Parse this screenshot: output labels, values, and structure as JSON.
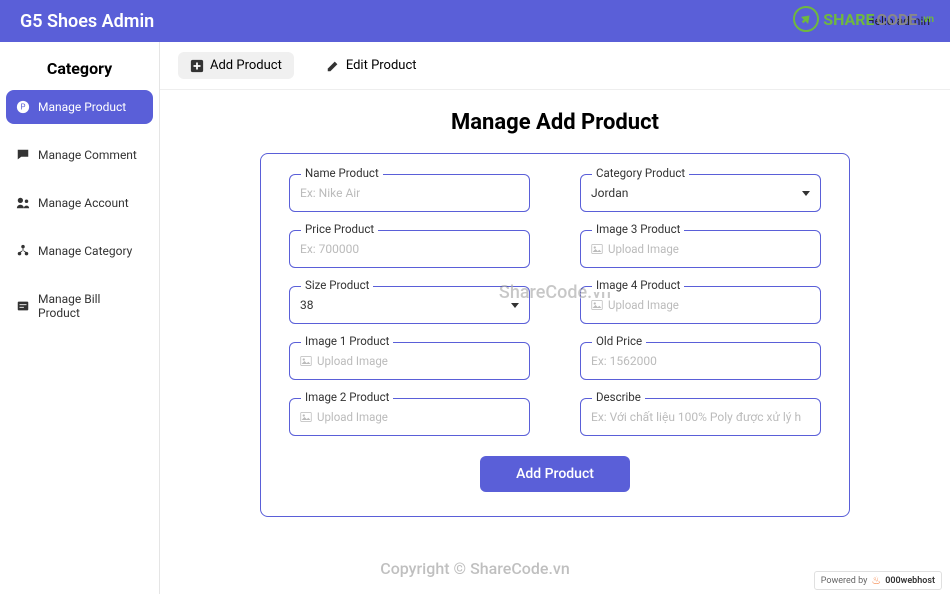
{
  "topbar": {
    "title": "G5 Shoes Admin",
    "greeting": "Hello admin"
  },
  "sidebar": {
    "heading": "Category",
    "items": [
      {
        "label": "Manage Product",
        "icon": "product",
        "active": true
      },
      {
        "label": "Manage Comment",
        "icon": "comment",
        "active": false
      },
      {
        "label": "Manage Account",
        "icon": "account",
        "active": false
      },
      {
        "label": "Manage Category",
        "icon": "category",
        "active": false
      },
      {
        "label": "Manage Bill Product",
        "icon": "bill",
        "active": false
      }
    ]
  },
  "tabs": [
    {
      "label": "Add Product",
      "icon": "plus",
      "active": true
    },
    {
      "label": "Edit Product",
      "icon": "edit",
      "active": false
    }
  ],
  "main": {
    "title": "Manage Add Product",
    "fields": {
      "name": {
        "label": "Name Product",
        "placeholder": "Ex: Nike Air"
      },
      "category": {
        "label": "Category Product",
        "value": "Jordan"
      },
      "price": {
        "label": "Price Product",
        "placeholder": "Ex: 700000"
      },
      "image3": {
        "label": "Image 3 Product",
        "upload_text": "Upload Image"
      },
      "size": {
        "label": "Size Product",
        "value": "38"
      },
      "image4": {
        "label": "Image 4 Product",
        "upload_text": "Upload Image"
      },
      "image1": {
        "label": "Image 1 Product",
        "upload_text": "Upload Image"
      },
      "oldprice": {
        "label": "Old Price",
        "placeholder": "Ex: 1562000"
      },
      "image2": {
        "label": "Image 2 Product",
        "upload_text": "Upload Image"
      },
      "describe": {
        "label": "Describe",
        "placeholder": "Ex: Với chất liệu 100% Poly được xử lý h"
      }
    },
    "submit_label": "Add Product"
  },
  "watermark": {
    "center": "ShareCode.vn",
    "bottom": "Copyright © ShareCode.vn",
    "logo_share": "SHARE",
    "logo_code": "CODE",
    "logo_vn": ".vn"
  },
  "powered": {
    "prefix": "Powered by",
    "host": "000webhost"
  }
}
